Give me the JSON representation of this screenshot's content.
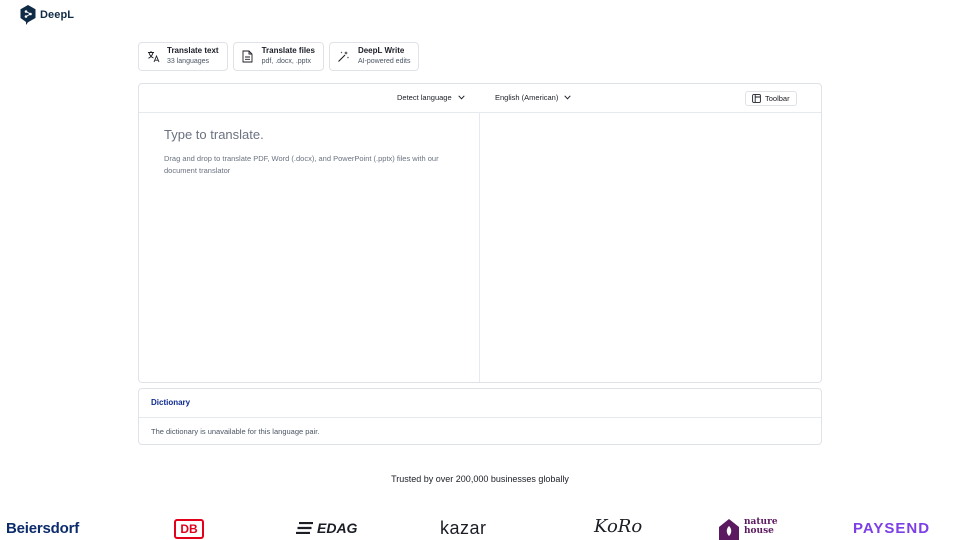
{
  "header": {
    "brand": "DeepL"
  },
  "modes": [
    {
      "title": "Translate text",
      "subtitle": "33 languages",
      "icon": "translate-icon"
    },
    {
      "title": "Translate files",
      "subtitle": "pdf, .docx, .pptx",
      "icon": "file-icon"
    },
    {
      "title": "DeepL Write",
      "subtitle": "AI-powered edits",
      "icon": "magic-wand-icon"
    }
  ],
  "translator": {
    "source_language": "Detect language",
    "target_language": "English (American)",
    "toolbar_label": "Toolbar",
    "placeholder": "Type to translate.",
    "drop_hint": "Drag and drop to translate PDF, Word (.docx), and PowerPoint (.pptx) files with our document translator"
  },
  "dictionary": {
    "title": "Dictionary",
    "message": "The dictionary is unavailable for this language pair."
  },
  "trusted": {
    "text": "Trusted by over 200,000 businesses globally"
  },
  "client_logos": {
    "beiersdorf": "Beiersdorf",
    "db": "DB",
    "edag": "EDAG",
    "kazar": "kazar",
    "koro": "KoRo",
    "nature_house_line1": "nature",
    "nature_house_line2": "house",
    "paysend": "PAYSEND"
  },
  "colors": {
    "brand_navy": "#0f2b46",
    "dictionary_title": "#0f2b8f",
    "db_red": "#e2001a",
    "paysend_purple": "#7b3fe4",
    "nature_house_plum": "#5b1a5f"
  }
}
